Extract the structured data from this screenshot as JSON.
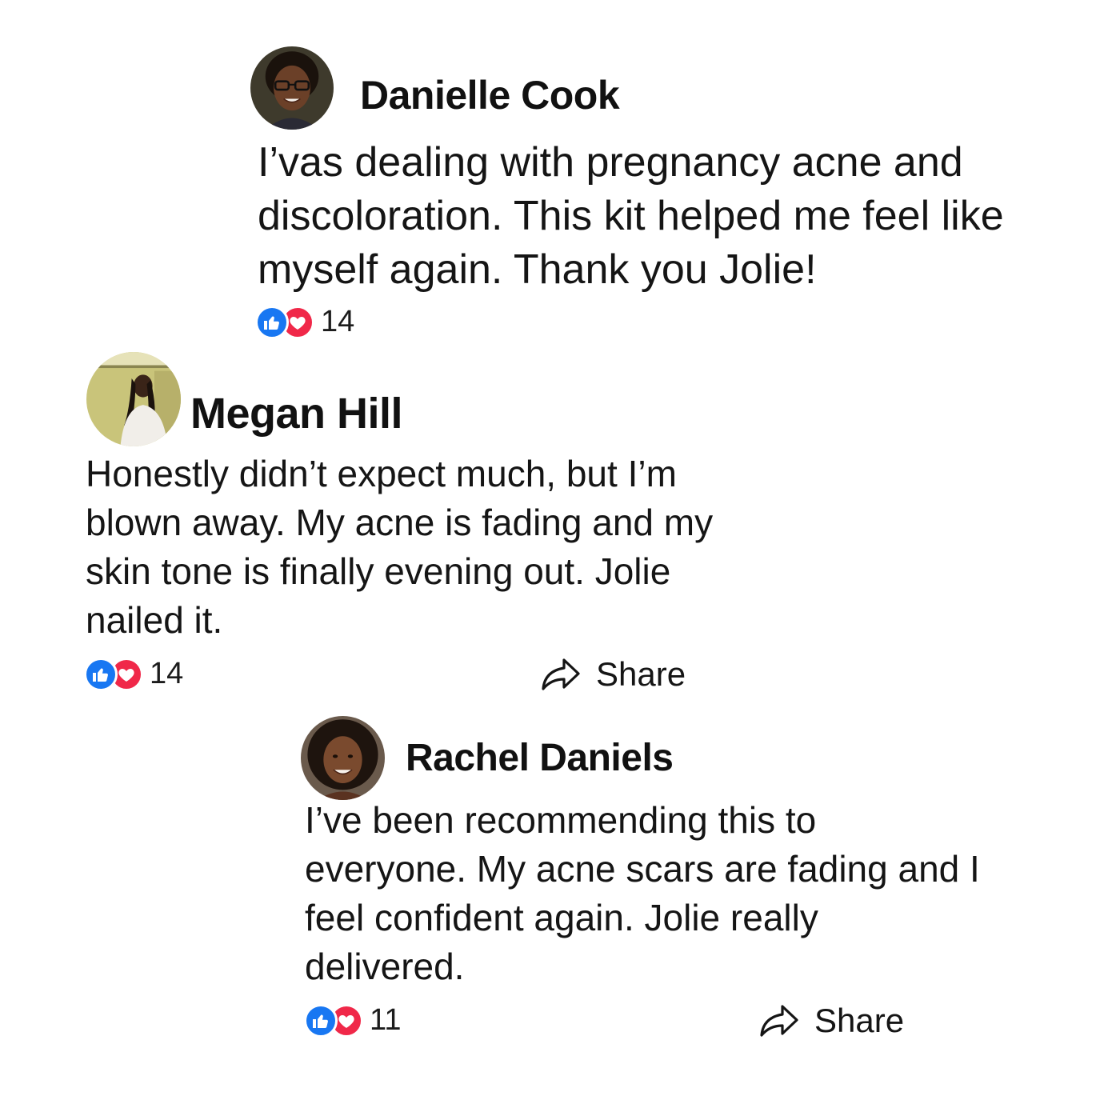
{
  "comments": [
    {
      "author": "Danielle Cook",
      "avatar_icon": "user-avatar",
      "text": "I’vas dealing with pregnancy acne and discoloration. This kit helped me feel like myself again. Thank you Jolie!",
      "reaction_icons": [
        "like-icon",
        "love-icon"
      ],
      "reaction_count": "14"
    },
    {
      "author": "Megan Hill",
      "avatar_icon": "user-avatar",
      "text": "Honestly didn’t expect much, but I’m blown away. My acne is fading and my skin tone is finally evening out. Jolie nailed it.",
      "reaction_icons": [
        "like-icon",
        "love-icon"
      ],
      "reaction_count": "14",
      "share_label": "Share"
    },
    {
      "author": "Rachel Daniels",
      "avatar_icon": "user-avatar",
      "text": "I’ve been recommending this to everyone. My acne scars are fading and I feel confident again. Jolie really delivered.",
      "reaction_icons": [
        "like-icon",
        "love-icon"
      ],
      "reaction_count": "11",
      "share_label": "Share"
    }
  ],
  "colors": {
    "like": "#1877f2",
    "love": "#f02849",
    "text": "#151515",
    "background": "#ffffff"
  }
}
